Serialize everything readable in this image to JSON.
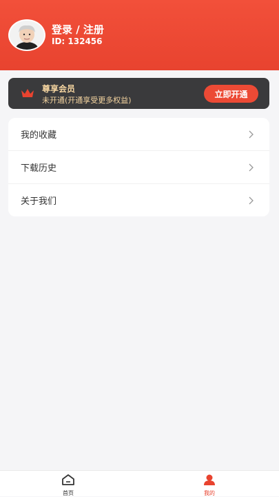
{
  "header": {
    "title": "登录 / 注册",
    "id_text": "ID: 132456"
  },
  "vip": {
    "title": "尊享会员",
    "subtitle": "未开通(开通享受更多权益)",
    "button": "立即开通",
    "icon": "crown-icon"
  },
  "menu": {
    "items": [
      {
        "label": "我的收藏",
        "icon": "chevron-right-icon"
      },
      {
        "label": "下载历史",
        "icon": "chevron-right-icon"
      },
      {
        "label": "关于我们",
        "icon": "chevron-right-icon"
      }
    ]
  },
  "tabbar": {
    "home": {
      "label": "首页",
      "icon": "home-icon"
    },
    "mine": {
      "label": "我的",
      "icon": "user-icon"
    }
  },
  "colors": {
    "primary": "#e8432f",
    "vip_bg": "#3a3a3c",
    "vip_gold": "#f4d4a0",
    "page_bg": "#f5f5f7"
  }
}
